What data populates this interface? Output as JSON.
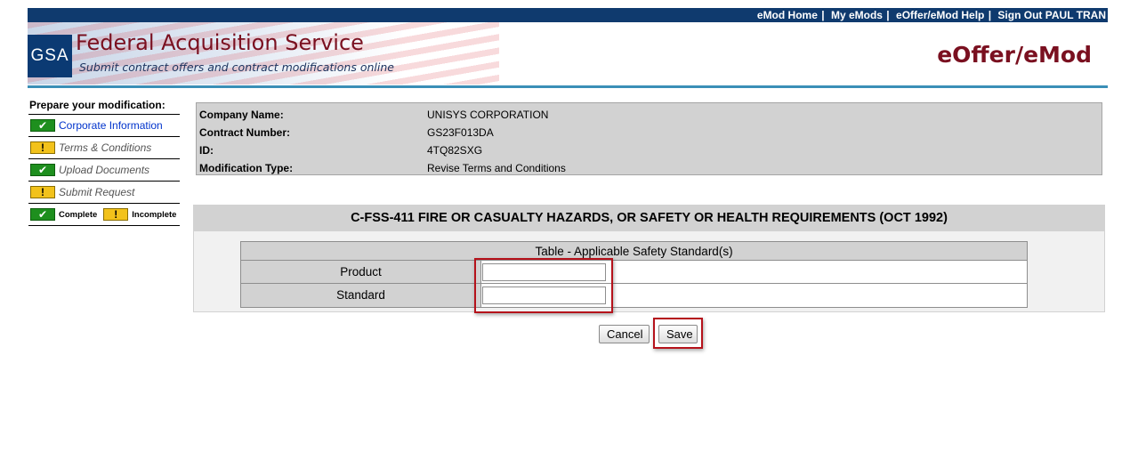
{
  "topnav": {
    "links": [
      "eMod Home",
      "My eMods",
      "eOffer/eMod Help",
      "Sign Out"
    ],
    "user": "PAUL TRAN"
  },
  "header": {
    "logo_text": "GSA",
    "title": "Federal Acquisition Service",
    "subtitle": "Submit contract offers and contract modifications online",
    "brand": "eOffer/eMod",
    "colors": {
      "topbar": "#0f3a6e",
      "title": "#7a1020",
      "rule": "#3a8fb7"
    }
  },
  "sidebar": {
    "title": "Prepare your modification:",
    "steps": [
      {
        "label": "Corporate Information",
        "status": "complete",
        "icon": "check-icon"
      },
      {
        "label": "Terms & Conditions",
        "status": "incomplete",
        "icon": "exclamation-icon"
      },
      {
        "label": "Upload Documents",
        "status": "complete",
        "icon": "check-icon"
      },
      {
        "label": "Submit Request",
        "status": "incomplete",
        "icon": "exclamation-icon"
      }
    ],
    "legend": {
      "complete": "Complete",
      "incomplete": "Incomplete"
    }
  },
  "info": {
    "rows": [
      {
        "key": "Company Name:",
        "value": "UNISYS CORPORATION"
      },
      {
        "key": "Contract Number:",
        "value": "GS23F013DA"
      },
      {
        "key": "ID:",
        "value": "4TQ82SXG"
      },
      {
        "key": "Modification Type:",
        "value": "Revise Terms and Conditions"
      }
    ]
  },
  "clause": {
    "heading": "C-FSS-411 FIRE OR CASUALTY HAZARDS, OR SAFETY OR HEALTH REQUIREMENTS (OCT 1992)",
    "table_caption": "Table - Applicable Safety Standard(s)",
    "rows": [
      {
        "label": "Product",
        "value": ""
      },
      {
        "label": "Standard",
        "value": ""
      }
    ]
  },
  "actions": {
    "cancel": "Cancel",
    "save": "Save"
  }
}
